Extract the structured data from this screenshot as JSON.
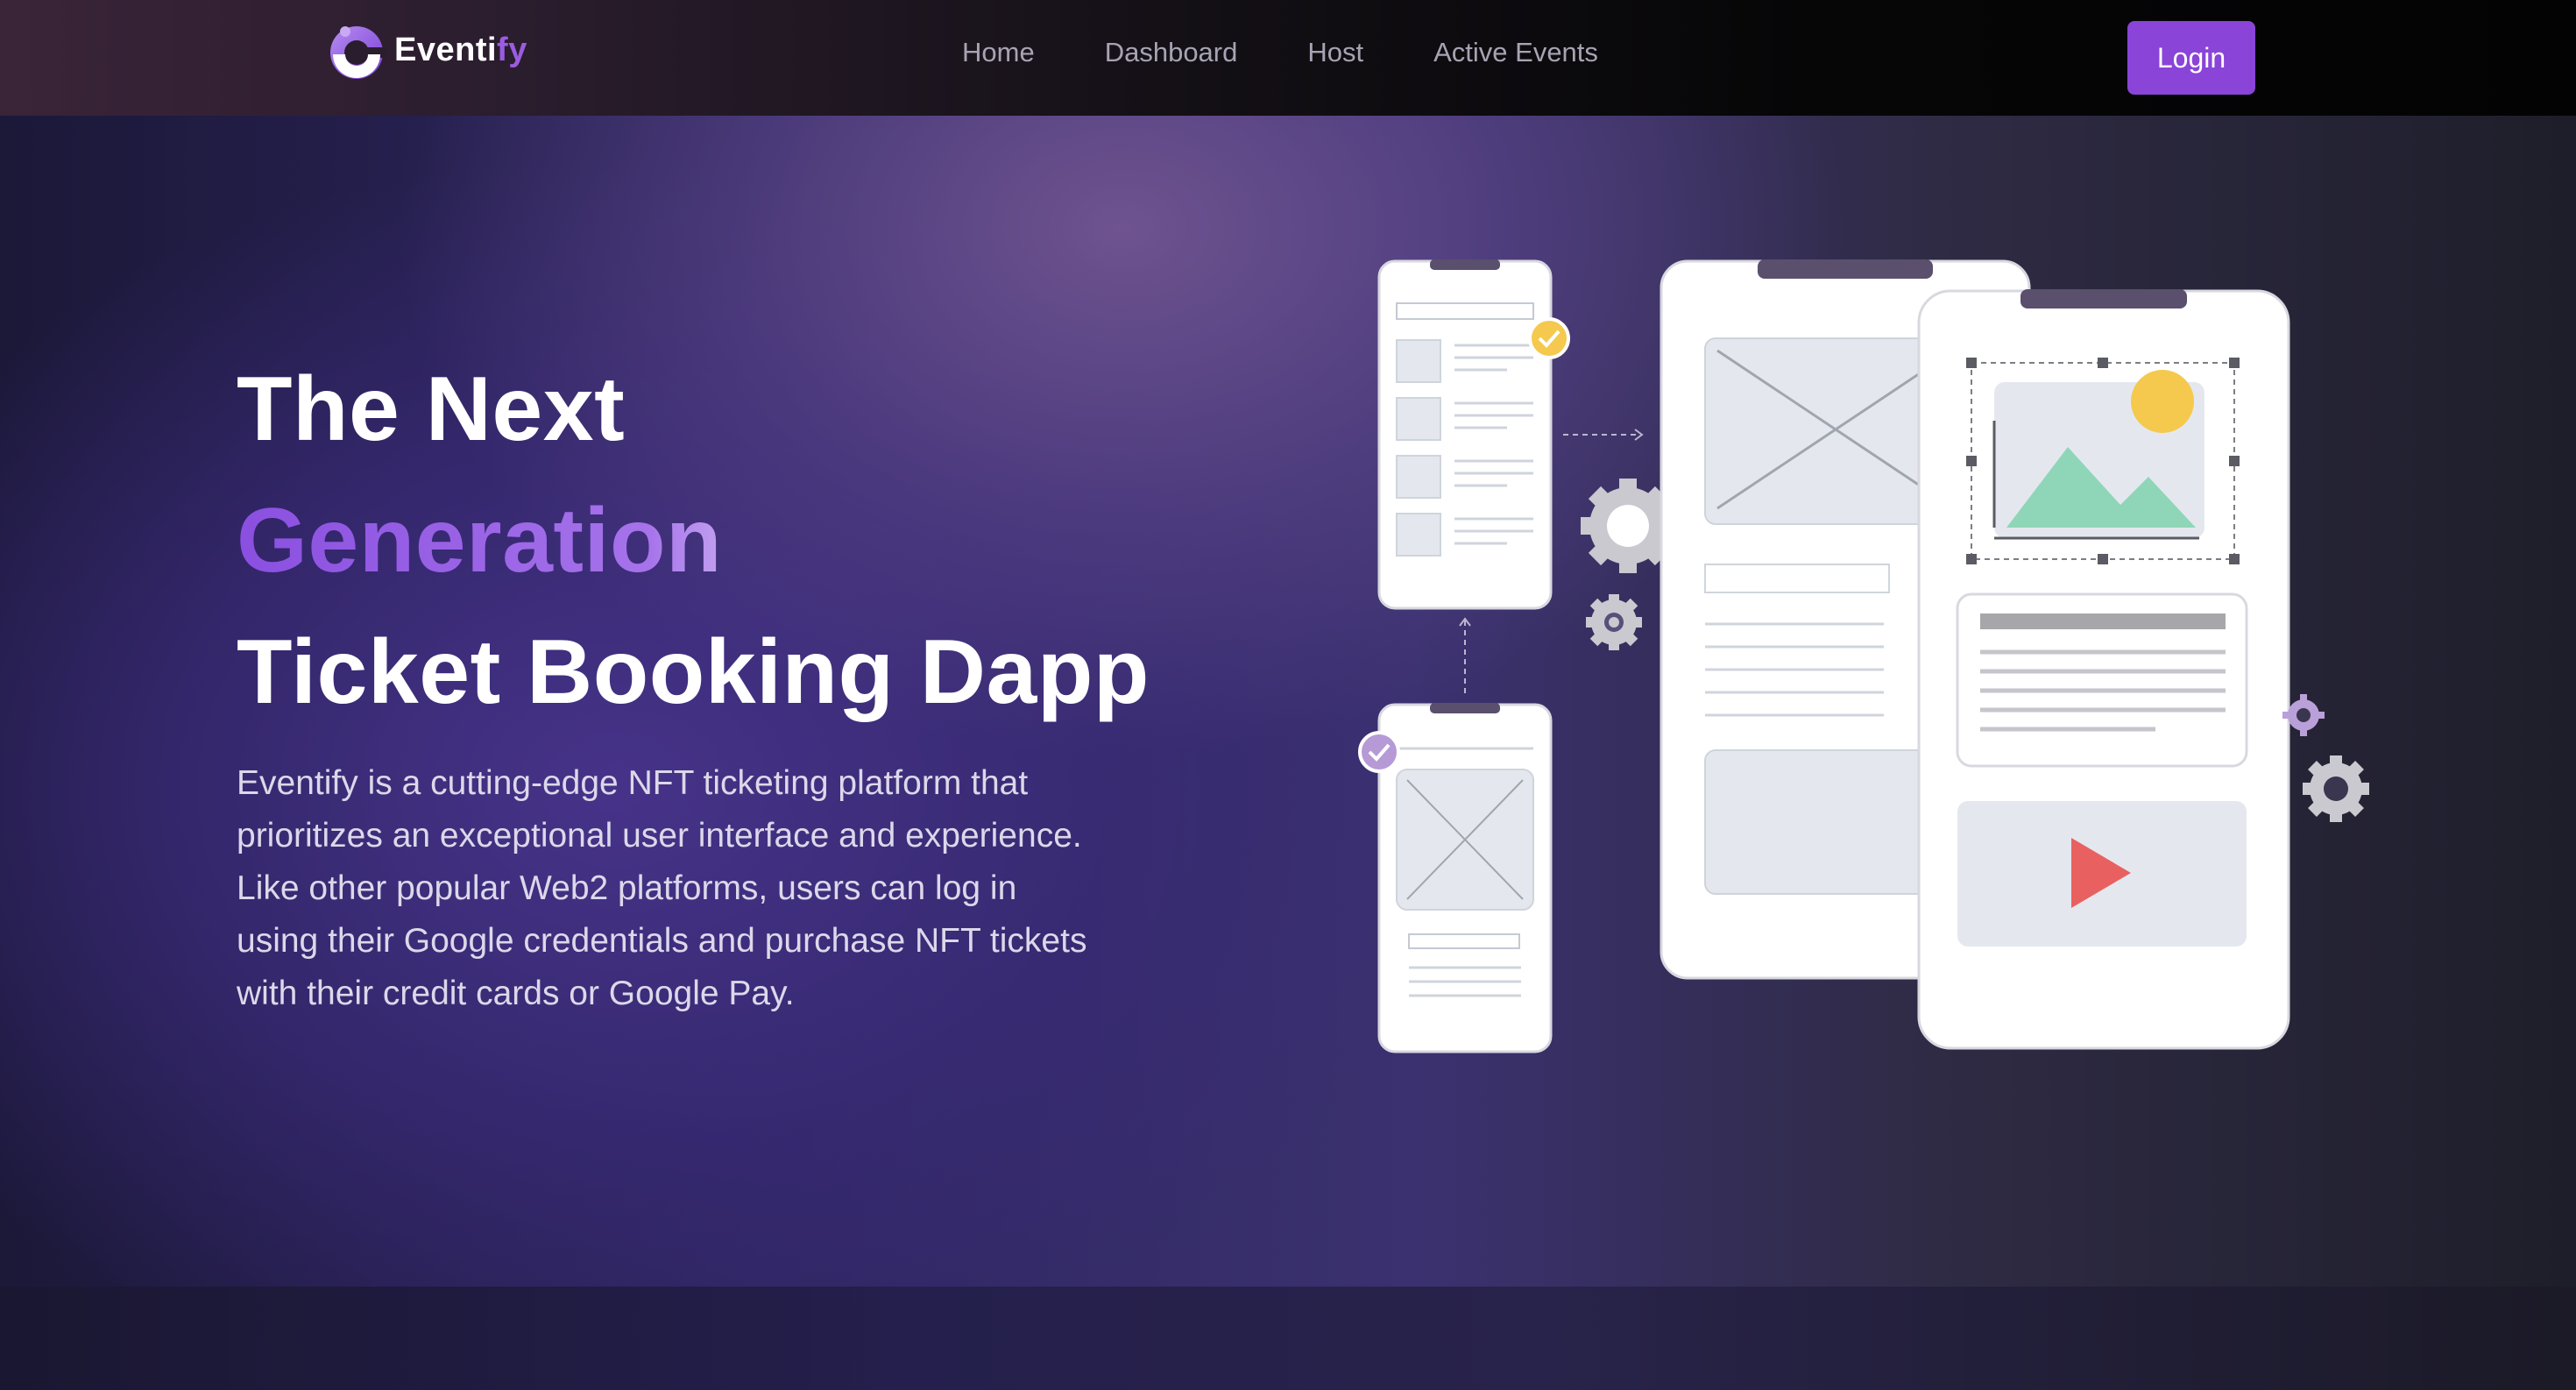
{
  "brand": {
    "name_main": "Eventi",
    "name_accent": "fy",
    "accent_color": "#8a44d8",
    "logo_icon": "eventify-logo-icon"
  },
  "nav": {
    "links": [
      {
        "label": "Home"
      },
      {
        "label": "Dashboard"
      },
      {
        "label": "Host"
      },
      {
        "label": "Active Events"
      }
    ],
    "login_label": "Login"
  },
  "hero": {
    "title_line1": "The Next",
    "title_line2": "Generation",
    "title_line3": "Ticket Booking Dapp",
    "description": "Eventify is a cutting-edge NFT ticketing platform that prioritizes an exceptional user interface and experience. Like other popular Web2 platforms, users can log in using their Google credentials and purchase NFT tickets with their credit cards or Google Pay."
  }
}
